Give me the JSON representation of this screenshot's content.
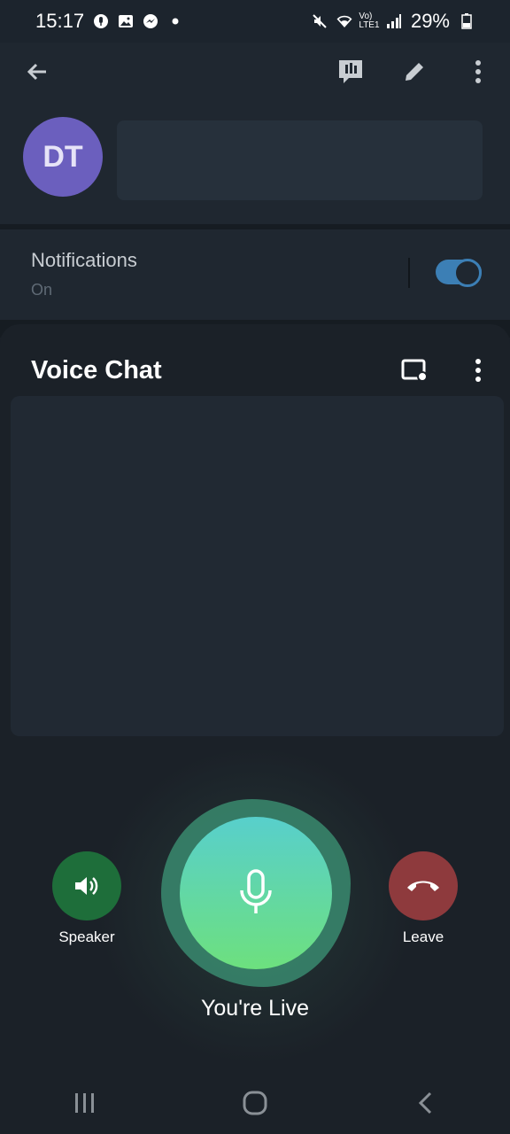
{
  "status_bar": {
    "time": "15:17",
    "battery": "29%",
    "network_label": "Vo) LTE1",
    "left_icons": [
      "podcast-icon",
      "gallery-icon",
      "messenger-icon",
      "dot-icon"
    ],
    "right_icons": [
      "mute-icon",
      "wifi-icon",
      "lte-icon",
      "signal-icon",
      "battery-icon"
    ]
  },
  "header": {
    "avatar_initials": "DT",
    "avatar_color": "#6b5fbe",
    "icons": [
      "back-arrow-icon",
      "live-stream-icon",
      "pencil-icon",
      "more-vertical-icon"
    ]
  },
  "notifications": {
    "title": "Notifications",
    "status": "On",
    "enabled": true,
    "accent": "#3c7fb5"
  },
  "voice_chat": {
    "title": "Voice Chat",
    "icons": [
      "screen-share-icon",
      "more-vertical-icon"
    ],
    "speaker_label": "Speaker",
    "leave_label": "Leave",
    "live_label": "You're Live",
    "speaker_color": "#1e6e3a",
    "leave_color": "#8e3a3d"
  },
  "nav_bar": {
    "icons": [
      "recent-apps-icon",
      "home-icon",
      "back-icon"
    ]
  }
}
